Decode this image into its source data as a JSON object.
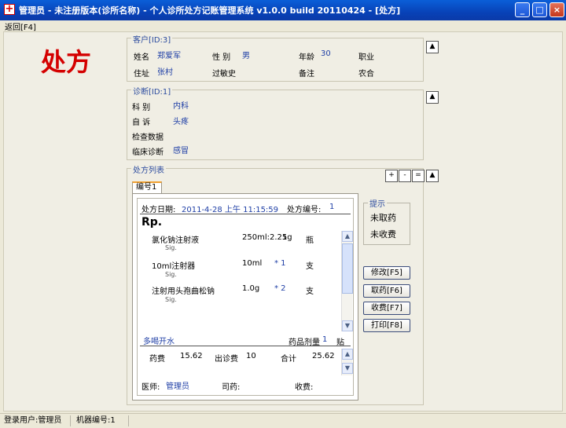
{
  "window": {
    "title": "管理员 - 未注册版本(诊所名称) - 个人诊所处方记账管理系统 v1.0.0 build 20110424 - [处方]",
    "app_icon": "red-cross-icon",
    "minimize": "_",
    "maximize": "□",
    "close": "×"
  },
  "menu": {
    "back": "返回[F4]"
  },
  "page_heading": "处方",
  "customer": {
    "caption": "客户[ID:3]",
    "name_label": "姓名",
    "name": "郑爱军",
    "sex_label": "性  别",
    "sex": "男",
    "age_label": "年龄",
    "age": "30",
    "job_label": "职业",
    "address_label": "住址",
    "address": "张村",
    "allergy_label": "过敏史",
    "note_label": "备注",
    "extra": "农合",
    "collapse_icon": "▲"
  },
  "diagnosis": {
    "caption": "诊断[ID:1]",
    "dept_label": "科    别",
    "dept": "内科",
    "complaint_label": "自    诉",
    "complaint": "头疼",
    "exam_label": "检查数据",
    "clinical_label": "临床诊断",
    "clinical": "感冒",
    "collapse_icon": "▲"
  },
  "rx_list": {
    "caption": "处方列表",
    "add": "+",
    "remove": "-",
    "equal": "=",
    "collapse_icon": "▲",
    "tab_label": "编号1"
  },
  "rx": {
    "date_label": "处方日期:",
    "date": "2011-4-28 上午 11:15:59",
    "number_label": "处方编号:",
    "number": "1",
    "rp": "Rp.",
    "items": [
      {
        "name": "氯化钠注射液",
        "spec": "250ml:2.25g",
        "qty": "1",
        "unit": "瓶",
        "usage": "Sig."
      },
      {
        "name": "10ml注射器",
        "spec": "10ml",
        "qty": "* 1",
        "unit": "支",
        "usage": "Sig."
      },
      {
        "name": "注射用头孢曲松钠",
        "spec": "1.0g",
        "qty": "* 2",
        "unit": "支",
        "usage": "Sig."
      }
    ],
    "advice": "多喝开水",
    "dose_label": "药品剂量",
    "dose": "1",
    "dose_unit": "贴",
    "drug_fee_label": "药费",
    "drug_fee": "15.62",
    "visit_fee_label": "出诊费",
    "visit_fee": "10",
    "total_label": "合计",
    "total": "25.62",
    "doctor_label": "医师:",
    "doctor": "管理员",
    "pharmacist_label": "司药:",
    "cashier_label": "收费:"
  },
  "hint": {
    "caption": "提示",
    "line1": "未取药",
    "line2": "未收费"
  },
  "actions": {
    "edit": "修改[F5]",
    "dispense": "取药[F6]",
    "charge": "收费[F7]",
    "print": "打印[F8]"
  },
  "status": {
    "user": "登录用户:管理员",
    "machine": "机器编号:1"
  }
}
